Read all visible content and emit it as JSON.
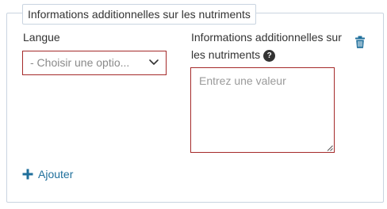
{
  "fieldset": {
    "legend": "Informations additionnelles sur les nutriments"
  },
  "language": {
    "label": "Langue",
    "placeholder": "- Choisir une optio..."
  },
  "info": {
    "label": "Informations additionnelles sur les nutriments",
    "help_icon": "?",
    "placeholder": "Entrez une valeur"
  },
  "actions": {
    "add_label": "Ajouter"
  },
  "colors": {
    "border": "#c9d4e0",
    "error_border": "#a52a2a",
    "accent": "#1f6f9b"
  },
  "icons": {
    "help": "question-circle-icon",
    "dropdown": "chevron-down-icon",
    "delete": "trash-icon",
    "add": "plus-icon"
  }
}
